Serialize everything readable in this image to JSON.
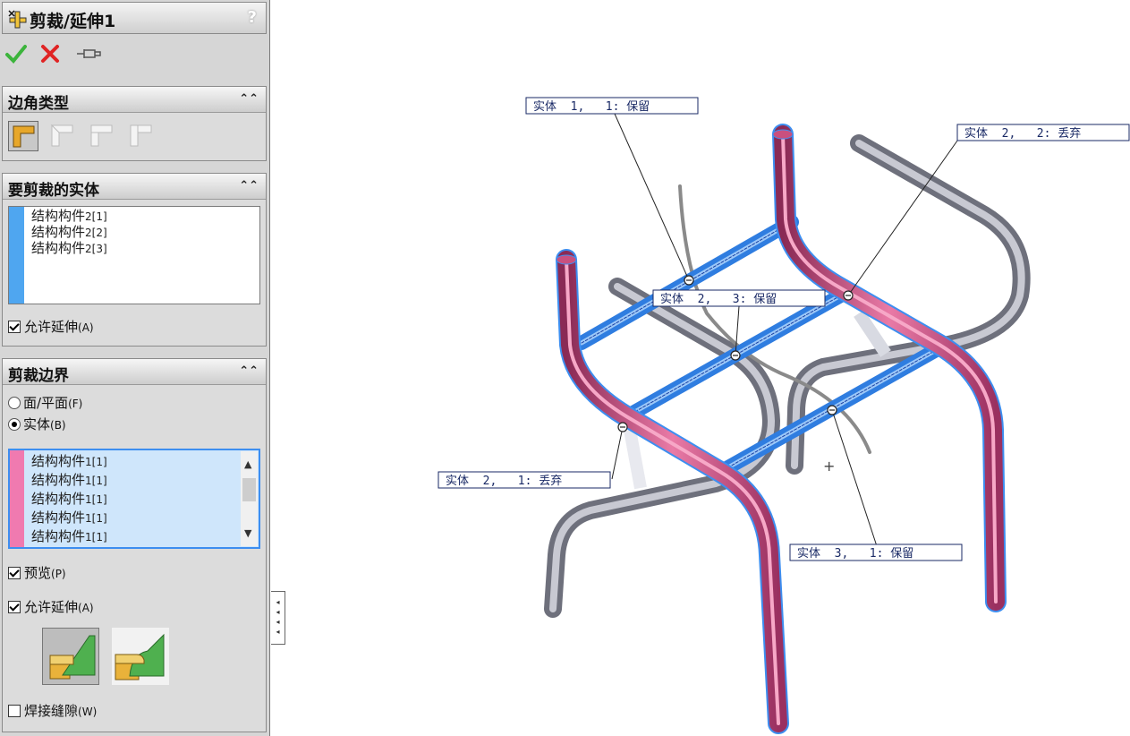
{
  "title_bar": {
    "title": "剪裁/延伸1",
    "help": "?"
  },
  "actions": {
    "ok": "ok-icon",
    "cancel": "cancel-icon",
    "pin": "pin-icon"
  },
  "corner_type": {
    "header": "边角类型",
    "selected_index": 0
  },
  "bodies_to_trim": {
    "header": "要剪裁的实体",
    "items": [
      {
        "name": "结构构件",
        "idx": "2[1]"
      },
      {
        "name": "结构构件",
        "idx": "2[2]"
      },
      {
        "name": "结构构件",
        "idx": "2[3]"
      }
    ],
    "allow_extend": {
      "label": "允许延伸",
      "key": "(A)",
      "checked": true
    }
  },
  "trim_boundary": {
    "header": "剪裁边界",
    "face_option": {
      "label": "面/平面",
      "key": "(F)",
      "selected": false
    },
    "body_option": {
      "label": "实体",
      "key": "(B)",
      "selected": true
    },
    "items": [
      {
        "name": "结构构件",
        "idx": "1[1]"
      },
      {
        "name": "结构构件",
        "idx": "1[1]"
      },
      {
        "name": "结构构件",
        "idx": "1[1]"
      },
      {
        "name": "结构构件",
        "idx": "1[1]"
      },
      {
        "name": "结构构件",
        "idx": "1[1]"
      }
    ],
    "preview": {
      "label": "预览",
      "key": "(P)",
      "checked": true
    },
    "allow_extend": {
      "label": "允许延伸",
      "key": "(A)",
      "checked": true
    },
    "weld_gap": {
      "label": "焊接缝隙",
      "key": "(W)",
      "checked": false
    }
  },
  "callouts": [
    {
      "text": "实体  1,   1: 保留"
    },
    {
      "text": "实体  2,   2: 丢弃"
    },
    {
      "text": "实体  2,   3: 保留"
    },
    {
      "text": "实体  2,   1: 丢弃"
    },
    {
      "text": "实体  3,   1: 保留"
    }
  ],
  "colors": {
    "boundary_strip": "#f07ab0",
    "trim_strip": "#4fa6f0",
    "pink_tube": "#d65a8c",
    "gray_tube": "#8c8e9a",
    "blue_highlight": "#3d8ef0"
  }
}
